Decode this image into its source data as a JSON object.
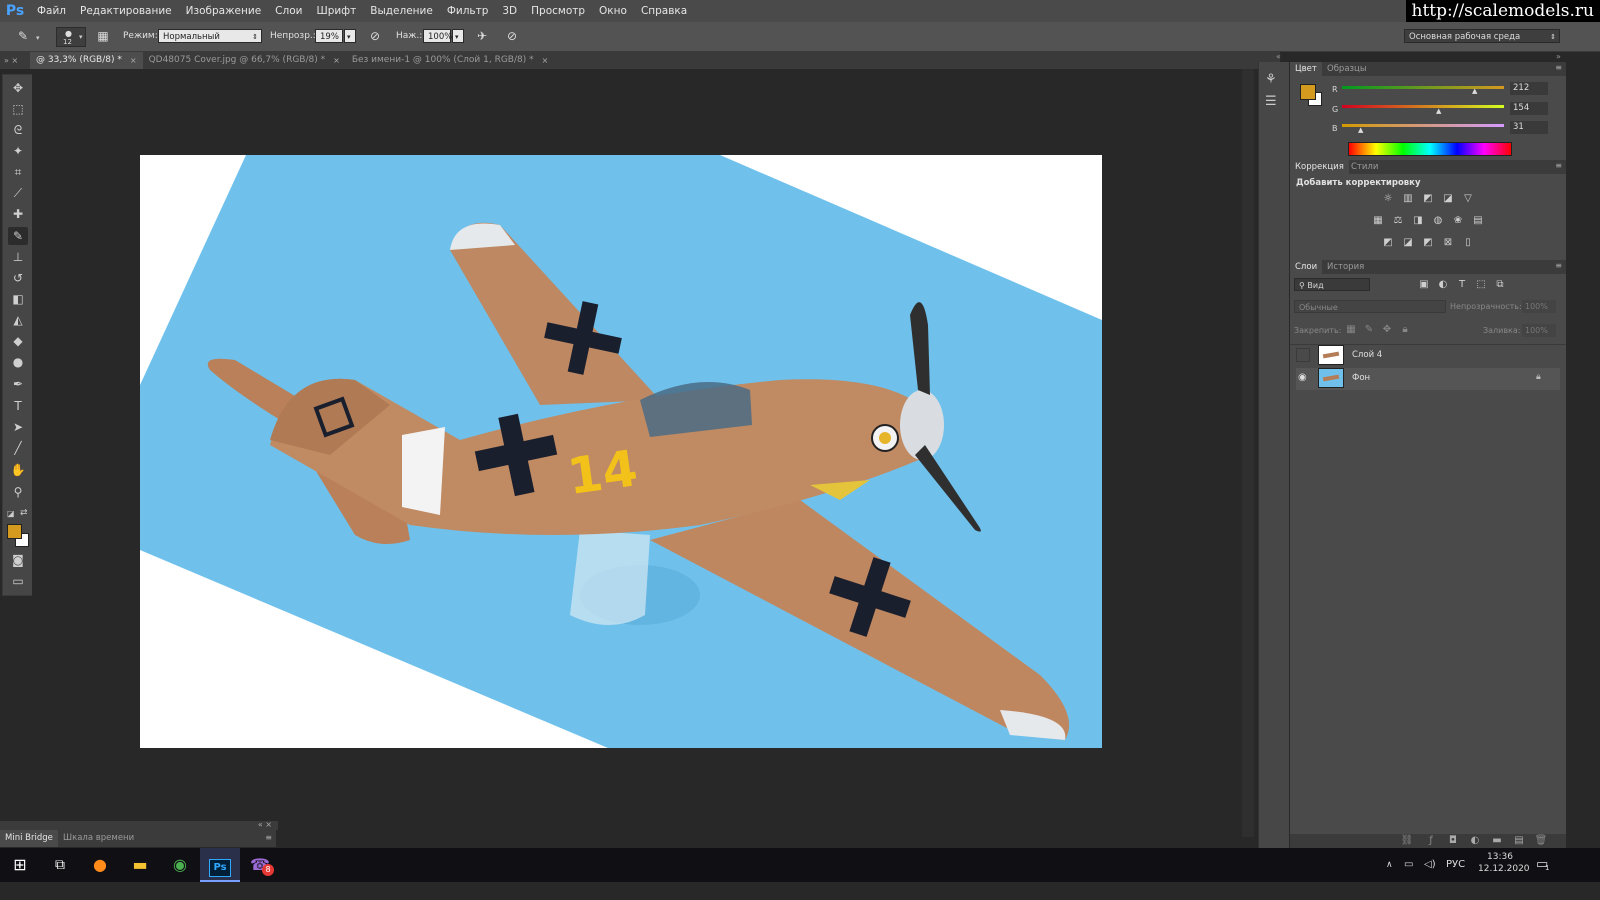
{
  "app": {
    "logo": "Ps"
  },
  "menu": [
    "Файл",
    "Редактирование",
    "Изображение",
    "Слои",
    "Шрифт",
    "Выделение",
    "Фильтр",
    "3D",
    "Просмотр",
    "Окно",
    "Справка"
  ],
  "watermark": "http://scalemodels.ru",
  "options": {
    "brush_size": "12",
    "mode_label": "Режим:",
    "mode_value": "Нормальный",
    "opacity_label": "Непрозр.:",
    "opacity_value": "19%",
    "pressure_label": "Наж.:",
    "pressure_value": "100%",
    "workspace": "Основная рабочая среда"
  },
  "tabs": [
    {
      "label": "@ 33,3% (RGB/8) *",
      "active": true
    },
    {
      "label": "QD48075 Cover.jpg @ 66,7% (RGB/8) *",
      "active": false
    },
    {
      "label": "Без имени-1 @ 100% (Слой 1, RGB/8) *",
      "active": false
    }
  ],
  "canvas": {
    "aircraft_number": "14",
    "colors": {
      "sky": "#6fc1ec",
      "plane": "#c08a62",
      "number": "#f2c21a",
      "paper": "#ffffff"
    }
  },
  "color_panel": {
    "tabs": [
      "Цвет",
      "Образцы"
    ],
    "foreground": "#d49a1f",
    "channels": [
      {
        "name": "R",
        "value": "212"
      },
      {
        "name": "G",
        "value": "154"
      },
      {
        "name": "B",
        "value": "31"
      }
    ]
  },
  "adjust_panel": {
    "tabs": [
      "Коррекция",
      "Стили"
    ],
    "title": "Добавить корректировку"
  },
  "layers_panel": {
    "tabs": [
      "Слои",
      "История"
    ],
    "filter": "Вид",
    "blend": "Обычные",
    "opacity_label": "Непрозрачность:",
    "opacity_value": "100%",
    "lock_label": "Закрепить:",
    "fill_label": "Заливка:",
    "fill_value": "100%",
    "layers": [
      {
        "name": "Слой 4",
        "visible": false,
        "locked": false
      },
      {
        "name": "Фон",
        "visible": true,
        "locked": true
      }
    ]
  },
  "bottom_panel": {
    "tabs": [
      "Mini Bridge",
      "Шкала времени"
    ]
  },
  "taskbar": {
    "language": "РУС",
    "time": "13:36",
    "date": "12.12.2020",
    "notifications": "1",
    "viber_badge": "8"
  }
}
